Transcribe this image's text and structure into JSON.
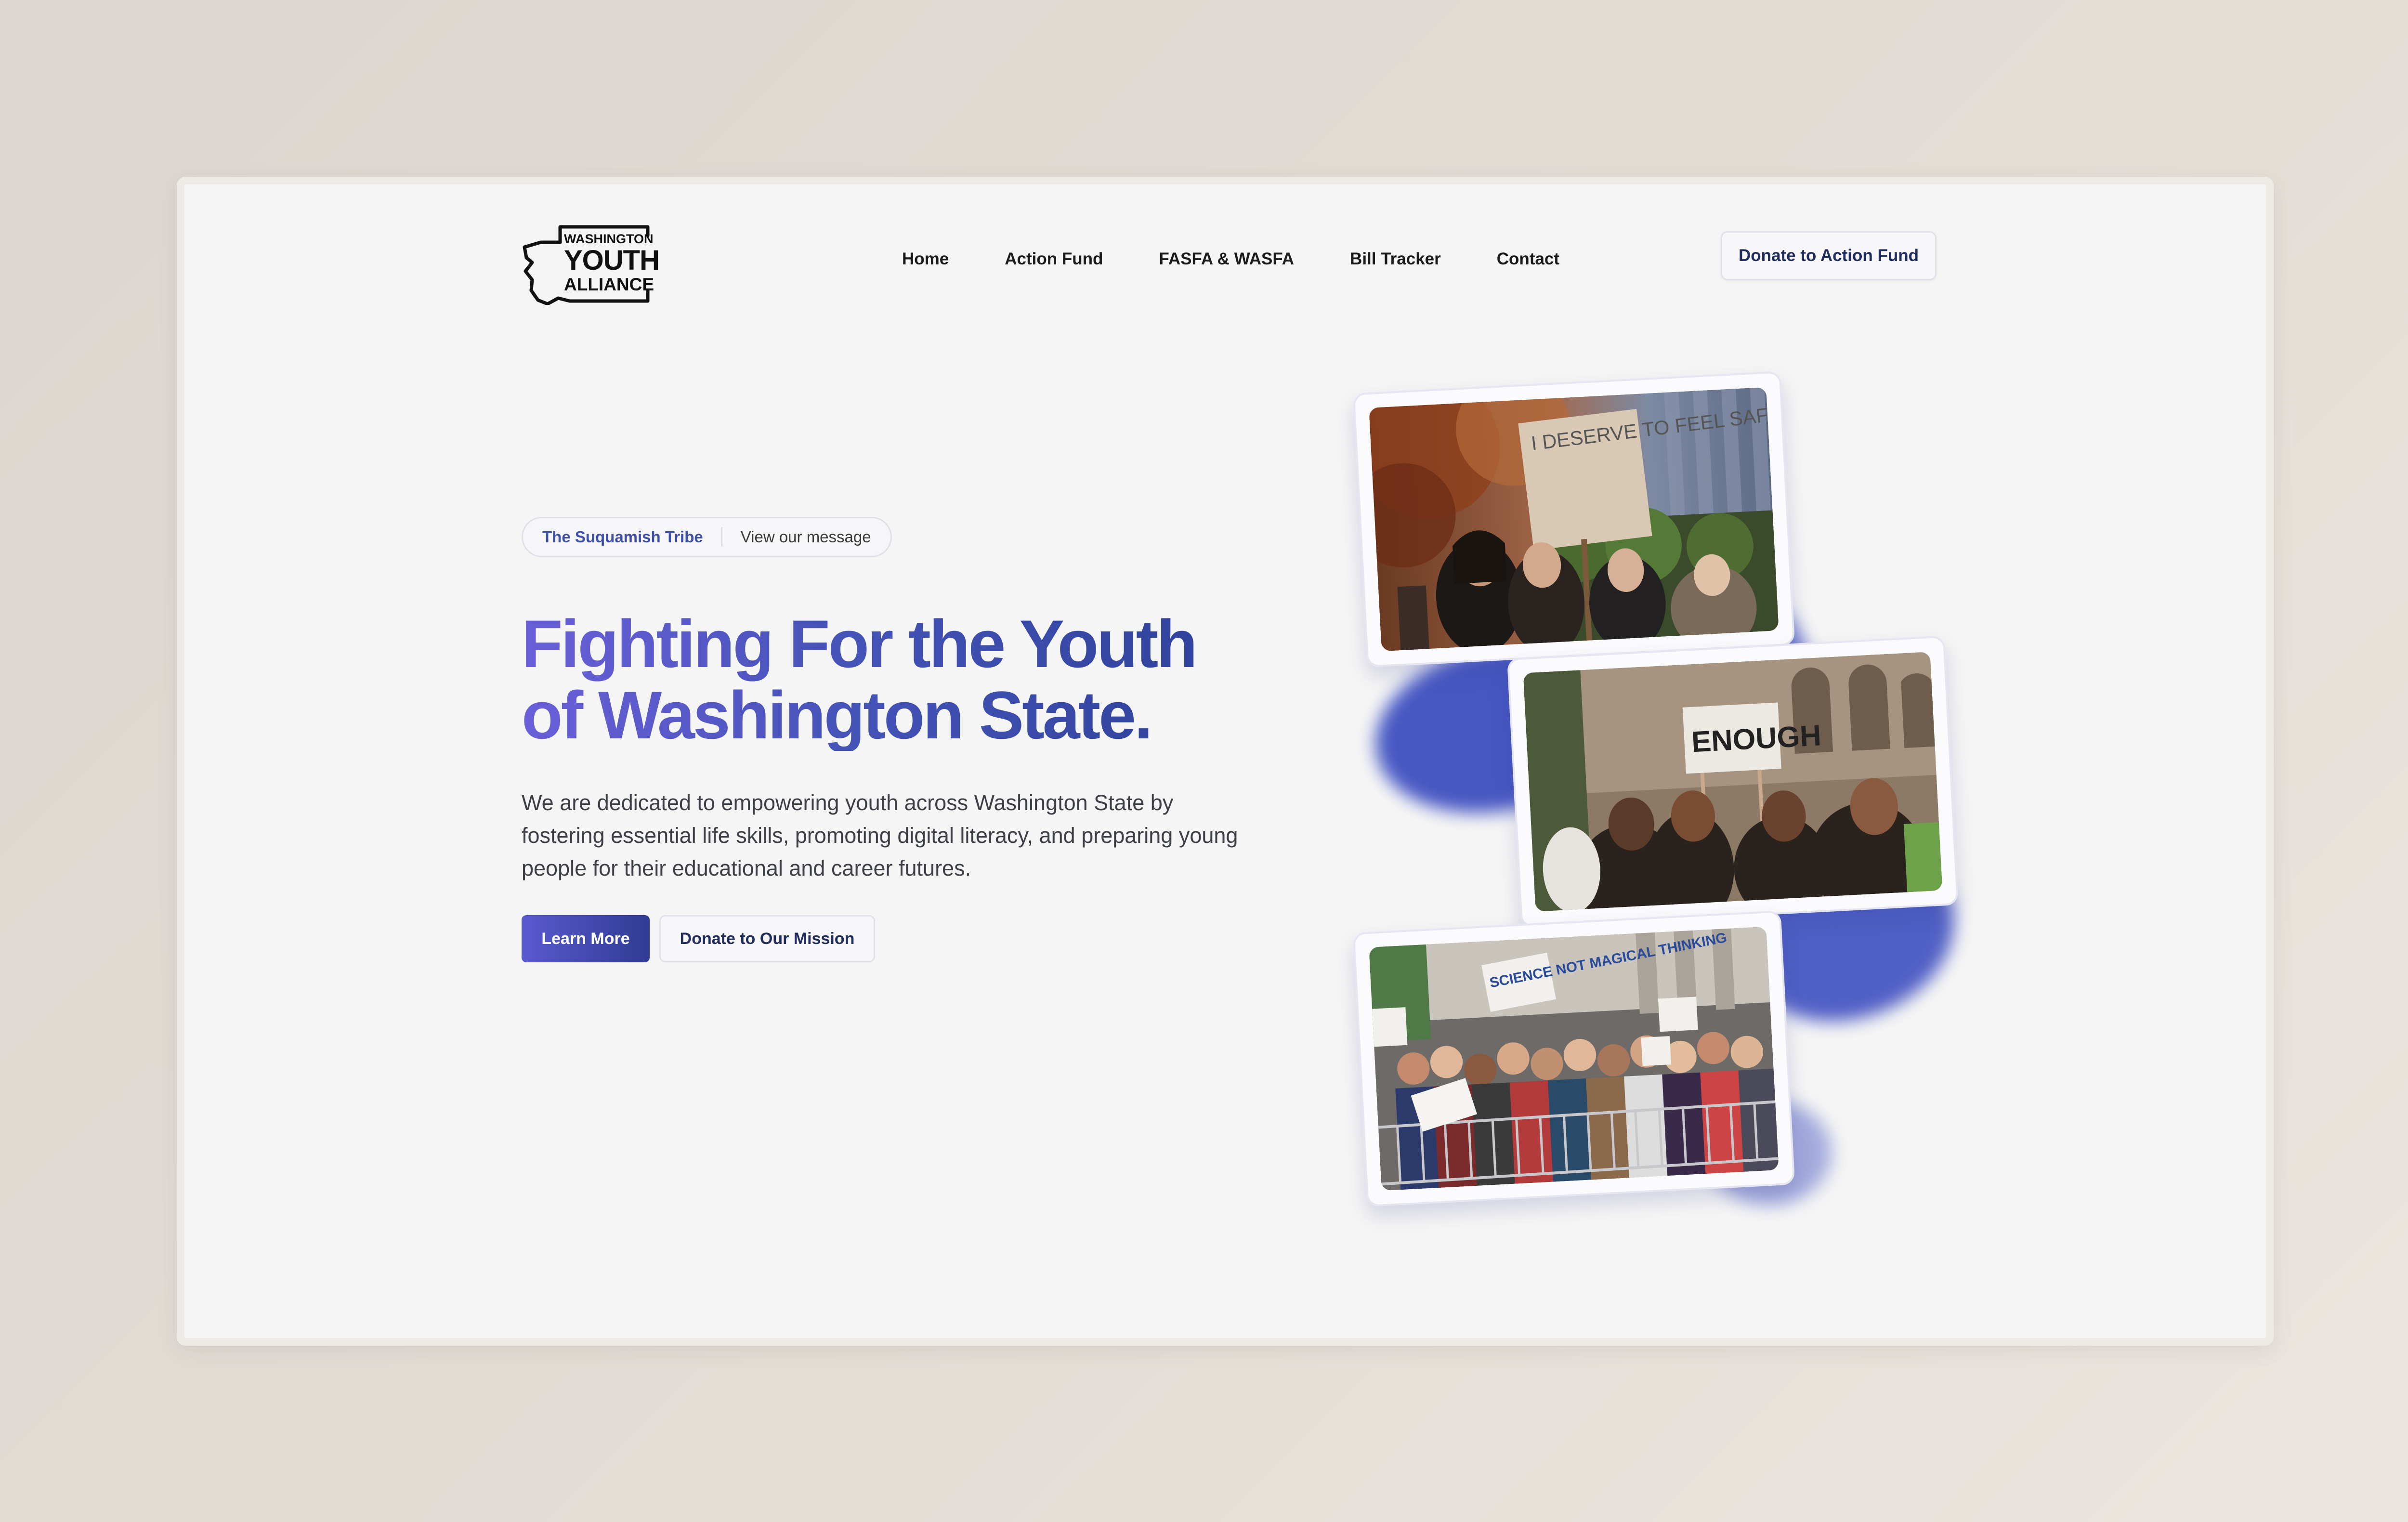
{
  "logo": {
    "line1": "WASHINGTON",
    "line2": "YOUTH",
    "line3": "ALLIANCE"
  },
  "nav": {
    "items": [
      "Home",
      "Action Fund",
      "FASFA & WASFA",
      "Bill Tracker",
      "Contact"
    ]
  },
  "header": {
    "cta_label": "Donate to Action Fund"
  },
  "hero": {
    "pill_highlight": "The Suquamish Tribe",
    "pill_link": "View our message",
    "title_line1": "Fighting For the Youth",
    "title_line2": "of Washington State.",
    "description": "We are dedicated to empowering youth across Washington State by fostering essential life skills, promoting digital literacy, and preparing young people for their educational and career futures.",
    "primary_button": "Learn More",
    "secondary_button": "Donate to Our Mission"
  },
  "photos": {
    "sign1": "I DESERVE TO FEEL SAFE AT SCHOOL",
    "sign2": "ENOUGH",
    "sign3": "SCIENCE NOT MAGICAL THINKING"
  },
  "colors": {
    "accent": "#4650b4",
    "accent_dark": "#2f3c92",
    "accent_light": "#6a5fd8",
    "button_text_dark": "#1f2c5c",
    "page_bg": "#f5f5f5"
  }
}
